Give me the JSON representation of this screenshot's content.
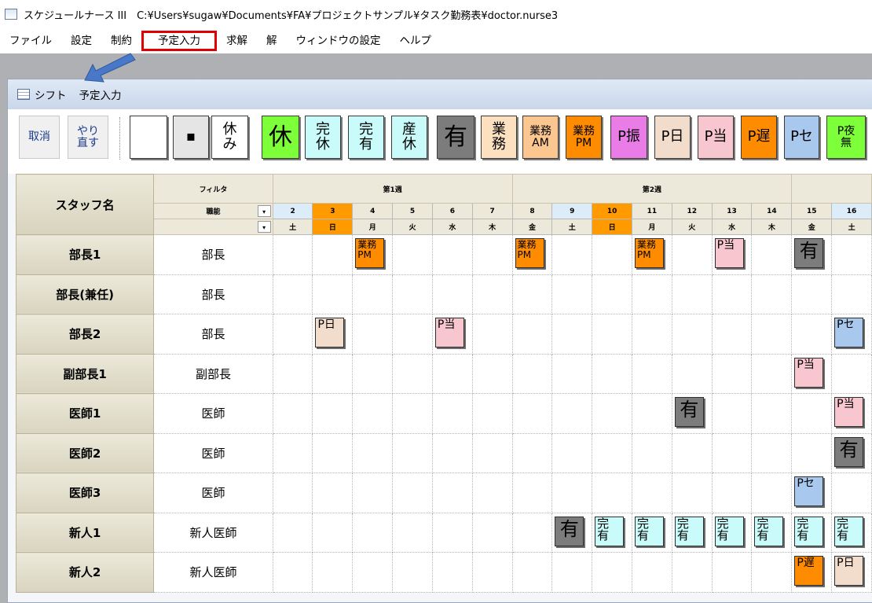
{
  "window": {
    "title": "スケジュールナース III　C:¥Users¥sugaw¥Documents¥FA¥プロジェクトサンプル¥タスク勤務表¥doctor.nurse3"
  },
  "menu": [
    {
      "label": "ファイル",
      "highlight": false
    },
    {
      "label": "設定",
      "highlight": false
    },
    {
      "label": "制約",
      "highlight": false
    },
    {
      "label": "予定入力",
      "highlight": true
    },
    {
      "label": "求解",
      "highlight": false
    },
    {
      "label": "解",
      "highlight": false
    },
    {
      "label": "ウィンドウの設定",
      "highlight": false
    },
    {
      "label": "ヘルプ",
      "highlight": false
    }
  ],
  "subwindow": {
    "tab1": "シフト",
    "tab2": "予定入力"
  },
  "palette": {
    "undo": "取消",
    "redo": "やり直す",
    "items": [
      {
        "lines": [
          ""
        ],
        "bg": "#ffffff",
        "style": "t2"
      },
      {
        "lines": [
          "▪"
        ],
        "bg": "#e5e5e5",
        "style": "t2"
      },
      {
        "lines": [
          "休",
          "み"
        ],
        "bg": "#ffffff",
        "style": "t2"
      },
      {
        "lines": [
          "休"
        ],
        "bg": "#7dff3a",
        "style": "tbig"
      },
      {
        "lines": [
          "完",
          "休"
        ],
        "bg": "#c8fbfa",
        "style": "t2"
      },
      {
        "lines": [
          "完",
          "有"
        ],
        "bg": "#c8fbfa",
        "style": "t2"
      },
      {
        "lines": [
          "産",
          "休"
        ],
        "bg": "#c8fbfa",
        "style": "t2"
      },
      {
        "lines": [
          "有"
        ],
        "bg": "#7c7c7c",
        "style": "tbig"
      },
      {
        "lines": [
          "業",
          "務"
        ],
        "bg": "#fce0c0",
        "style": "t2"
      },
      {
        "lines": [
          "業務",
          "AM"
        ],
        "bg": "#fcc690",
        "style": "tsmall"
      },
      {
        "lines": [
          "業務",
          "PM"
        ],
        "bg": "#ff8c00",
        "style": "tsmall"
      },
      {
        "lines": [
          "P振"
        ],
        "bg": "#e97ce6",
        "style": "t2"
      },
      {
        "lines": [
          "P日"
        ],
        "bg": "#f2dccb",
        "style": "t2"
      },
      {
        "lines": [
          "P当"
        ],
        "bg": "#f8c6cf",
        "style": "t2"
      },
      {
        "lines": [
          "P遅"
        ],
        "bg": "#ff8c00",
        "style": "t2"
      },
      {
        "lines": [
          "Pセ"
        ],
        "bg": "#a8c8ee",
        "style": "t2"
      },
      {
        "lines": [
          "P夜",
          "無"
        ],
        "bg": "#7dff3a",
        "style": "tsmall"
      }
    ]
  },
  "grid": {
    "staff_header": "スタッフ名",
    "filter_label": "フィルタ",
    "role_filter_label": "職能",
    "dropdown_icon": "▾",
    "weeks": [
      {
        "label": "第1週",
        "span": 6
      },
      {
        "label": "第2週",
        "span": 7
      },
      {
        "label": "",
        "span": 2
      }
    ],
    "days": [
      {
        "num": "2",
        "dow": "土",
        "type": "plain"
      },
      {
        "num": "3",
        "dow": "日",
        "type": "sun"
      },
      {
        "num": "4",
        "dow": "月",
        "type": "weekday"
      },
      {
        "num": "5",
        "dow": "火",
        "type": "weekday"
      },
      {
        "num": "6",
        "dow": "水",
        "type": "weekday"
      },
      {
        "num": "7",
        "dow": "木",
        "type": "weekday"
      },
      {
        "num": "8",
        "dow": "金",
        "type": "weekday"
      },
      {
        "num": "9",
        "dow": "土",
        "type": "plain"
      },
      {
        "num": "10",
        "dow": "日",
        "type": "sun"
      },
      {
        "num": "11",
        "dow": "月",
        "type": "weekday"
      },
      {
        "num": "12",
        "dow": "火",
        "type": "weekday"
      },
      {
        "num": "13",
        "dow": "水",
        "type": "weekday"
      },
      {
        "num": "14",
        "dow": "木",
        "type": "weekday"
      },
      {
        "num": "15",
        "dow": "金",
        "type": "weekday"
      },
      {
        "num": "16",
        "dow": "土",
        "type": "plain"
      }
    ],
    "rows": [
      {
        "name": "部長1",
        "role": "部長",
        "cells": {
          "2": "業務PM",
          "6": "業務PM",
          "9": "業務PM",
          "11": "P当",
          "13": "有"
        }
      },
      {
        "name": "部長(兼任)",
        "role": "部長",
        "cells": {}
      },
      {
        "name": "部長2",
        "role": "部長",
        "cells": {
          "1": "P日",
          "4": "P当",
          "14": "Pセ"
        }
      },
      {
        "name": "副部長1",
        "role": "副部長",
        "cells": {
          "13": "P当"
        }
      },
      {
        "name": "医師1",
        "role": "医師",
        "cells": {
          "10": "有",
          "14": "P当"
        }
      },
      {
        "name": "医師2",
        "role": "医師",
        "cells": {
          "14": "有"
        }
      },
      {
        "name": "医師3",
        "role": "医師",
        "cells": {
          "13": "Pセ"
        }
      },
      {
        "name": "新人1",
        "role": "新人医師",
        "cells": {
          "7": "有",
          "8": "完有",
          "9": "完有",
          "10": "完有",
          "11": "完有",
          "12": "完有",
          "13": "完有",
          "14": "完有"
        }
      },
      {
        "name": "新人2",
        "role": "新人医師",
        "cells": {
          "13": "P遅",
          "14": "P日"
        }
      }
    ]
  },
  "colors": {
    "業務PM": "#ff8c00",
    "P当": "#f8c6cf",
    "有": "#7c7c7c",
    "P日": "#f2dccb",
    "Pセ": "#a8c8ee",
    "完有": "#c8fbfa",
    "P遅": "#ff8c00",
    "arrow": "#4a78c8",
    "highlight_border": "#e00000"
  }
}
